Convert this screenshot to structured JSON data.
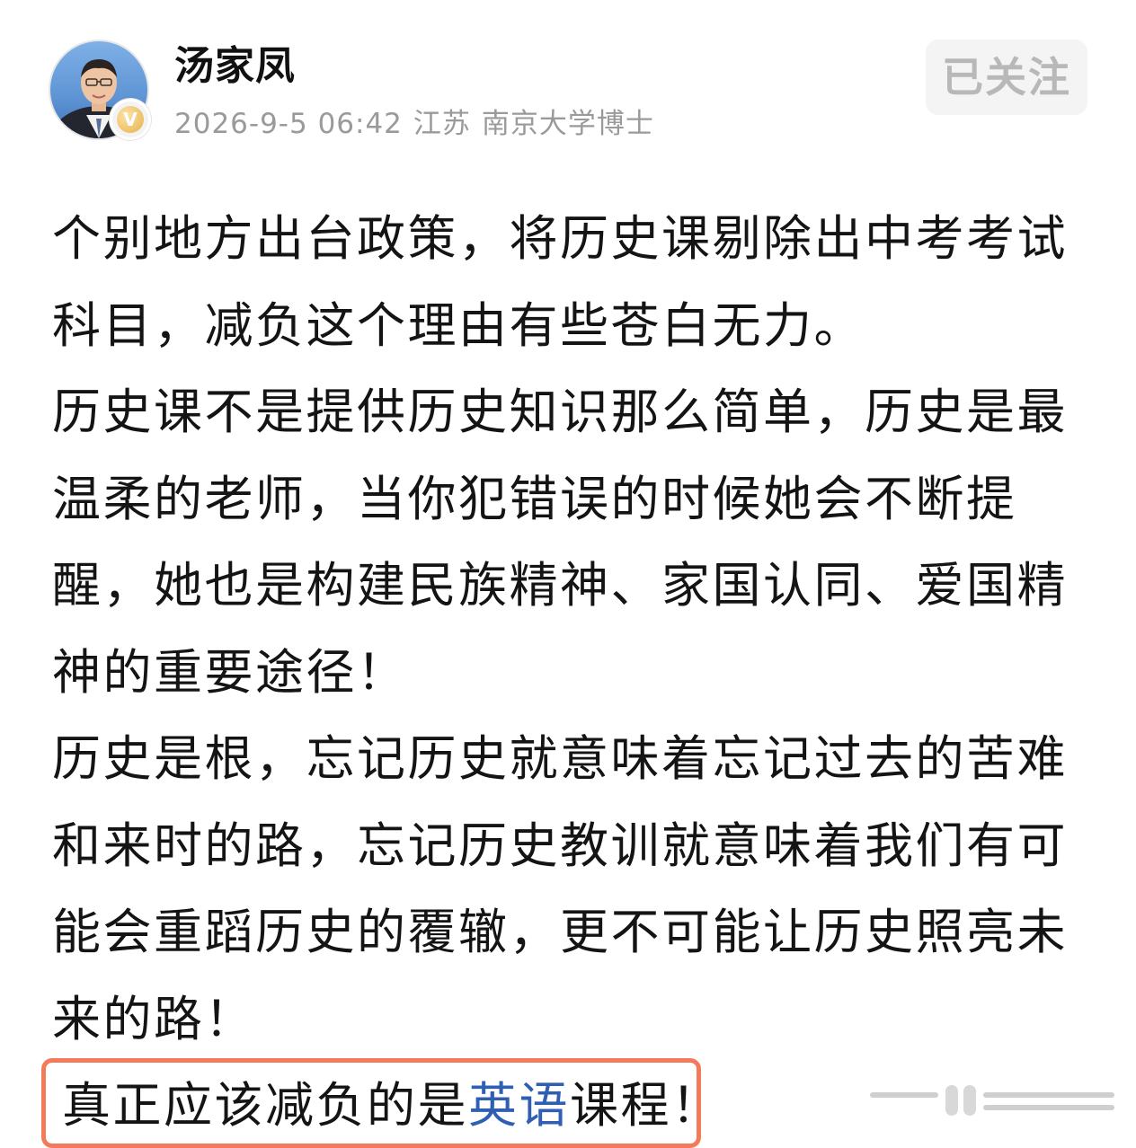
{
  "author": {
    "name": "汤家凤",
    "verified_badge": "V",
    "timestamp": "2026-9-5 06:42",
    "location": "江苏",
    "title": "南京大学博士"
  },
  "follow_button": {
    "label": "已关注"
  },
  "post": {
    "paragraphs": [
      "个别地方出台政策，将历史课剔除出中考考试科目，减负这个理由有些苍白无力。",
      "历史课不是提供历史知识那么简单，历史是最温柔的老师，当你犯错误的时候她会不断提醒，她也是构建民族精神、家国认同、爱国精神的重要途径！",
      "历史是根，忘记历史就意味着忘记过去的苦难和来时的路，忘记历史教训就意味着我们有可能会重蹈历史的覆辙，更不可能让历史照亮未来的路！"
    ],
    "highlight": {
      "before": "真正应该减负的是",
      "link": "英语",
      "after": "课程！"
    }
  },
  "colors": {
    "highlight_border": "#f47a5c",
    "link": "#2e5fb3",
    "meta_text": "#9a9a9a",
    "follow_text": "#b8b8b8"
  },
  "icons": {
    "verified": "verified-v-badge-icon"
  }
}
